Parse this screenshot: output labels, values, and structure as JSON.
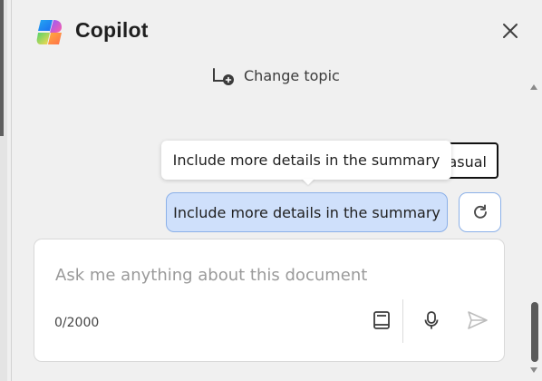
{
  "header": {
    "title": "Copilot",
    "logo_icon": "copilot-logo-icon",
    "close_icon": "close-icon"
  },
  "conversation": {
    "change_topic": {
      "label": "Change topic",
      "icon": "change-topic-icon"
    },
    "hidden_chip": {
      "visible_text": "casual"
    },
    "tooltip": {
      "text": "Include more details in the summary"
    },
    "suggestion": {
      "label": "Include more details in the summary"
    },
    "refresh_icon": "refresh-icon"
  },
  "input": {
    "placeholder": "Ask me anything about this document",
    "char_counter": "0/2000",
    "document_icon": "document-icon",
    "microphone_icon": "microphone-icon",
    "send_icon": "send-icon"
  },
  "colors": {
    "page_background": "#f0f0f0",
    "suggestion_fill": "#cfe0fb",
    "suggestion_border": "#8bb0e8",
    "title_text": "#1f1f1f"
  }
}
